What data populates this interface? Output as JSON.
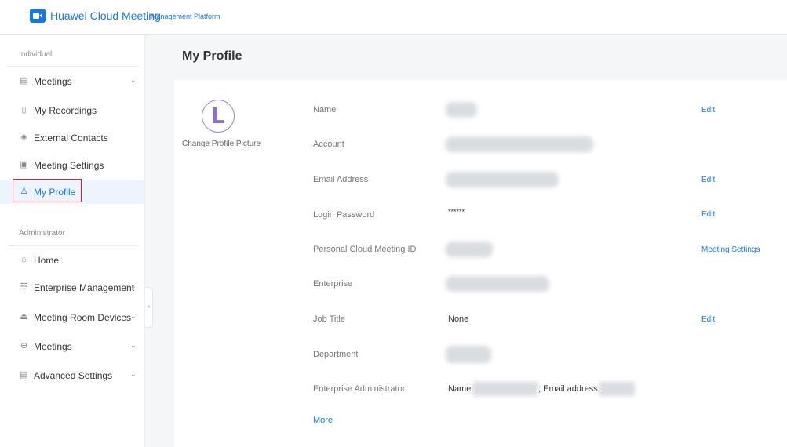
{
  "header": {
    "brand": "Huawei Cloud Meeting",
    "subtitle": "Management Platform",
    "logo_icon": "video-camera-icon",
    "accent": "#1677e5"
  },
  "sidebar": {
    "individual_label": "Individual",
    "administrator_label": "Administrator",
    "individual_items": [
      {
        "label": "Meetings",
        "icon": "calendar-icon",
        "expandable": true
      },
      {
        "label": "My Recordings",
        "icon": "file-icon",
        "expandable": false
      },
      {
        "label": "External Contacts",
        "icon": "contact-icon",
        "expandable": false
      },
      {
        "label": "Meeting Settings",
        "icon": "settings-card-icon",
        "expandable": false
      },
      {
        "label": "My Profile",
        "icon": "user-icon",
        "expandable": false,
        "active": true
      }
    ],
    "admin_items": [
      {
        "label": "Home",
        "icon": "home-icon",
        "expandable": false
      },
      {
        "label": "Enterprise Management",
        "icon": "org-icon",
        "expandable": true
      },
      {
        "label": "Meeting Room Devices",
        "icon": "device-icon",
        "expandable": true
      },
      {
        "label": "Meetings",
        "icon": "globe-icon",
        "expandable": true
      },
      {
        "label": "Advanced Settings",
        "icon": "advanced-icon",
        "expandable": true
      }
    ]
  },
  "main": {
    "title": "My Profile",
    "avatar_letter": "L",
    "change_picture": "Change Profile Picture",
    "rows": [
      {
        "label": "Name",
        "action": "Edit"
      },
      {
        "label": "Account",
        "action": ""
      },
      {
        "label": "Email Address",
        "action": "Edit"
      },
      {
        "label": "Login Password",
        "value": "******",
        "action": "Edit"
      },
      {
        "label": "Personal Cloud Meeting ID",
        "action": "Meeting Settings"
      },
      {
        "label": "Enterprise",
        "action": ""
      },
      {
        "label": "Job Title",
        "value": "None",
        "action": "Edit"
      },
      {
        "label": "Department",
        "action": ""
      },
      {
        "label": "Enterprise Administrator",
        "admin_name_label": "Name:",
        "admin_email_label": "; Email address:",
        "action": ""
      }
    ],
    "more": "More"
  }
}
